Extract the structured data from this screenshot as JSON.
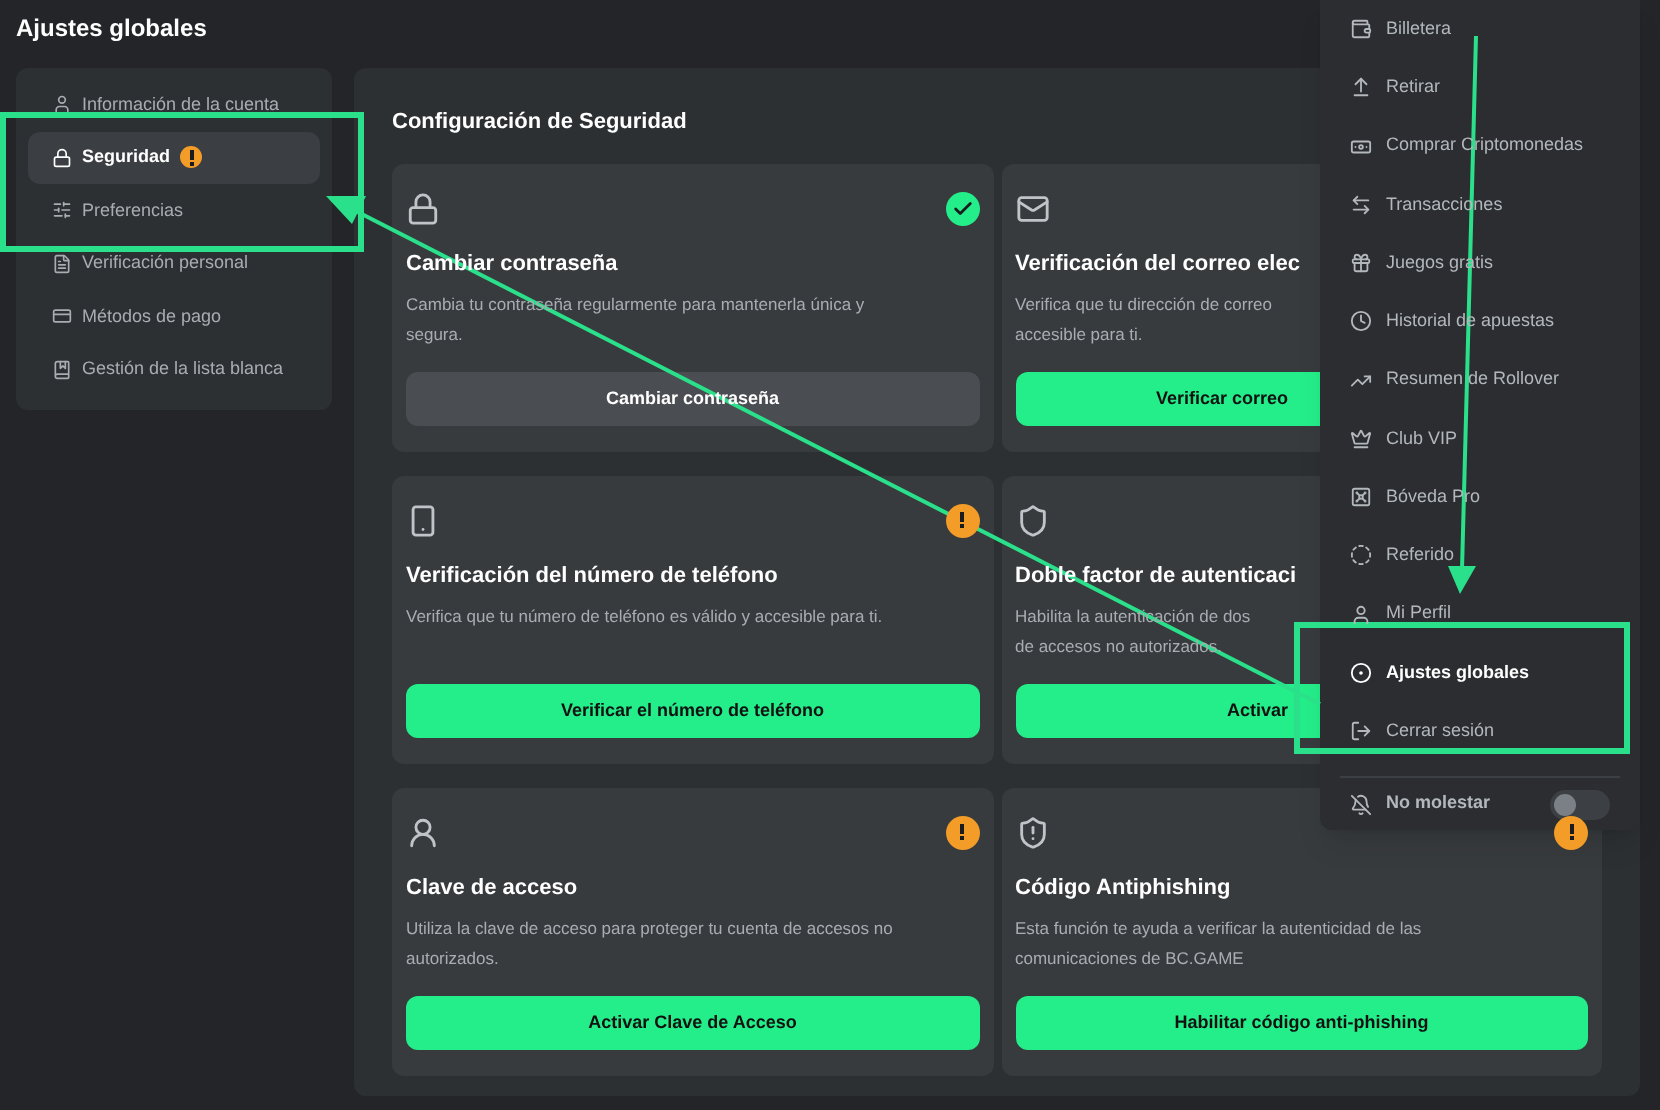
{
  "page_title": "Ajustes globales",
  "sidebar": {
    "items": [
      {
        "label": "Información de la cuenta",
        "selected": false,
        "warning": false
      },
      {
        "label": "Seguridad",
        "selected": true,
        "warning": true
      },
      {
        "label": "Preferencias",
        "selected": false,
        "warning": false
      },
      {
        "label": "Verificación personal",
        "selected": false,
        "warning": false
      },
      {
        "label": "Métodos de pago",
        "selected": false,
        "warning": false
      },
      {
        "label": "Gestión de la lista blanca",
        "selected": false,
        "warning": false
      }
    ]
  },
  "security": {
    "title": "Configuración de Seguridad",
    "cards": [
      {
        "title": "Cambiar contraseña",
        "verified": true,
        "warning": false,
        "description": [
          "Cambia tu contraseña regularmente para mantenerla única y",
          "segura."
        ],
        "button": {
          "label": "Cambiar contraseña",
          "kind": "secondary"
        }
      },
      {
        "title": "Verificación del correo elec",
        "verified": false,
        "warning": false,
        "description": [
          "Verifica que tu dirección de correo",
          "accesible para ti."
        ],
        "button": {
          "label": "Verificar correo",
          "kind": "primary"
        }
      },
      {
        "title": "Verificación del número de teléfono",
        "verified": false,
        "warning": true,
        "description": [
          "Verifica que tu número de teléfono es válido y accesible para ti."
        ],
        "button": {
          "label": "Verificar el número de teléfono",
          "kind": "primary"
        }
      },
      {
        "title": "Doble factor de autenticaci",
        "verified": false,
        "warning": false,
        "description": [
          "Habilita la autenticación de dos",
          "de accesos no autorizados."
        ],
        "button": {
          "label": "Activar",
          "kind": "primary"
        }
      },
      {
        "title": "Clave de acceso",
        "verified": false,
        "warning": true,
        "description": [
          "Utiliza la clave de acceso para proteger tu cuenta de accesos no",
          "autorizados."
        ],
        "button": {
          "label": "Activar Clave de Acceso",
          "kind": "primary"
        }
      },
      {
        "title": "Código Antiphishing",
        "verified": false,
        "warning": true,
        "description": [
          "Esta función te ayuda a verificar la autenticidad de las",
          "comunicaciones de BC.GAME"
        ],
        "button": {
          "label": "Habilitar código anti-phishing",
          "kind": "primary"
        }
      }
    ]
  },
  "menu": {
    "items": [
      {
        "label": "Billetera",
        "selected": false
      },
      {
        "label": "Retirar",
        "selected": false
      },
      {
        "label": "Comprar Criptomonedas",
        "selected": false
      },
      {
        "label": "Transacciones",
        "selected": false
      },
      {
        "label": "Juegos gratis",
        "selected": false
      },
      {
        "label": "Historial de apuestas",
        "selected": false
      },
      {
        "label": "Resumen de Rollover",
        "selected": false
      },
      {
        "label": "Club VIP",
        "selected": false
      },
      {
        "label": "Bóveda Pro",
        "selected": false
      },
      {
        "label": "Referido",
        "selected": false
      },
      {
        "label": "Mi Perfil",
        "selected": false
      },
      {
        "label": "Ajustes globales",
        "selected": true
      },
      {
        "label": "Cerrar sesión",
        "selected": false
      }
    ],
    "do_not_disturb": {
      "label": "No molestar",
      "on": false
    }
  }
}
